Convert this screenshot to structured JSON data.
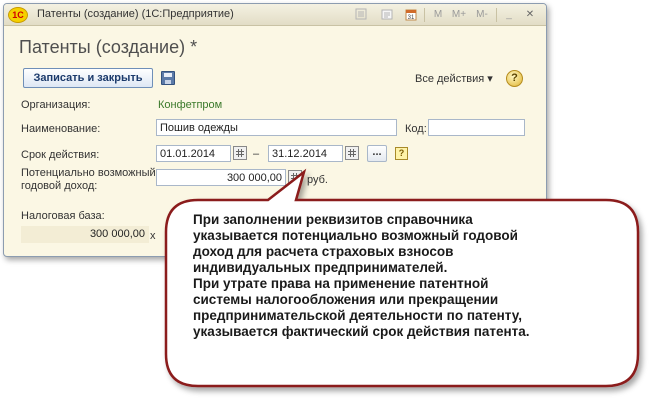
{
  "window": {
    "title": "Патенты (создание)  (1С:Предприятие)",
    "logo": "1С",
    "toolbar_icons": [
      "favorite-icon",
      "history-icon",
      "calendar-icon",
      "memory-icon",
      "memory-plus-icon",
      "memory-minus-icon",
      "minimize-icon",
      "close-icon"
    ],
    "toolbar_labels": {
      "m": "M",
      "m_plus": "M+",
      "m_minus": "M-",
      "minimize": "_",
      "close": "✕"
    }
  },
  "form": {
    "title": "Патенты (создание) *",
    "save_close_label": "Записать и закрыть",
    "all_actions_label": "Все действия ▾",
    "help_label": "?"
  },
  "fields": {
    "organization_label": "Организация:",
    "organization_value": "Конфетпром",
    "name_label": "Наименование:",
    "name_value": "Пошив одежды",
    "code_label": "Код:",
    "code_value": "",
    "term_label": "Срок действия:",
    "date_from": "01.01.2014",
    "date_dash": "–",
    "date_to": "31.12.2014",
    "ellipsis_label": "...",
    "question_label": "?",
    "income_label_line1": "Потенциально возможный",
    "income_label_line2": "годовой доход:",
    "income_value": "300 000,00",
    "income_unit": "руб.",
    "tax_base_label": "Налоговая база:",
    "tax_base_value": "300 000,00",
    "multiply_sign": "x"
  },
  "callout": {
    "lines": [
      "При заполнении реквизитов справочника",
      "указывается потенциально возможный годовой",
      "доход для расчета страховых взносов",
      "индивидуальных предпринимателей.",
      "При утрате права на применение патентной",
      "системы налогообложения или прекращении",
      "предпринимательской деятельности по патенту,",
      "указывается фактический срок действия патента."
    ],
    "fill_color": "#ffffff",
    "border_color": "#8b1a1a"
  }
}
